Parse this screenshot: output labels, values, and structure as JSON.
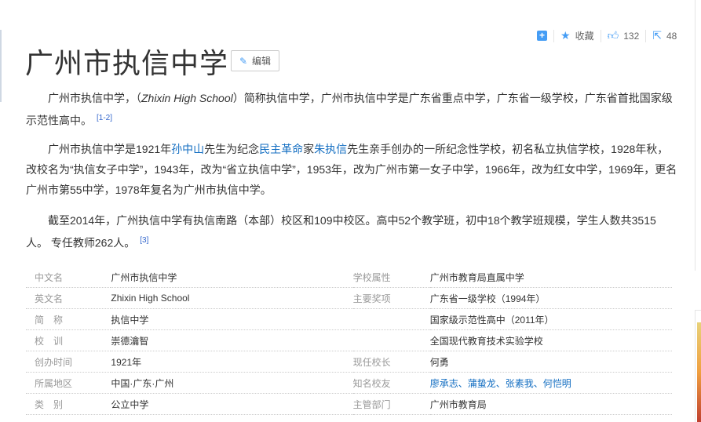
{
  "toolbar": {
    "collect": "收藏",
    "likes": "132",
    "shares": "48"
  },
  "title": "广州市执信中学",
  "edit_label": "编辑",
  "paragraphs": {
    "p1": {
      "a": "广州市执信中学，（",
      "en": "Zhixin High School",
      "b": "）简称执信中学，广州市执信中学是广东省重点中学，广东省一级学校，广东省首批国家级示范性高中。",
      "ref": "[1-2]"
    },
    "p2": {
      "a": "广州市执信中学是1921年",
      "l1": "孙中山",
      "b": "先生为纪念",
      "l2": "民主革命",
      "c": "家",
      "l3": "朱执信",
      "d": "先生亲手创办的一所纪念性学校，初名私立执信学校，1928年秋，改校名为“执信女子中学”，1943年，改为“省立执信中学”，1953年，改为广州市第一女子中学，1966年，改为红女中学，1969年，更名广州市第55中学，1978年复名为广州市执信中学。"
    },
    "p3": {
      "a": "截至2014年，广州执信中学有执信南路（本部）校区和109中校区。高中52个教学班，初中18个教学班规模，学生人数共3515人。 专任教师262人。",
      "ref": "[3]"
    }
  },
  "infobox": [
    {
      "l": "中文名",
      "v": "广州市执信中学",
      "l2": "学校属性",
      "v2": "广州市教育局直属中学"
    },
    {
      "l": "英文名",
      "v": "Zhixin High School",
      "l2": "主要奖项",
      "v2": "广东省一级学校（1994年）"
    },
    {
      "l": "简　称",
      "v": "执信中学",
      "l2": "",
      "v2": "国家级示范性高中（2011年）"
    },
    {
      "l": "校　训",
      "v": "崇德瀹智",
      "l2": "",
      "v2": "全国现代教育技术实验学校"
    },
    {
      "l": "创办时间",
      "v": "1921年",
      "l2": "现任校长",
      "v2": "何勇"
    },
    {
      "l": "所属地区",
      "v": "中国·广东·广州",
      "l2": "知名校友",
      "v2": "廖承志、蒲蛰龙、张素我、何恺明"
    },
    {
      "l": "类　别",
      "v": "公立中学",
      "l2": "主管部门",
      "v2": "广州市教育局"
    }
  ]
}
